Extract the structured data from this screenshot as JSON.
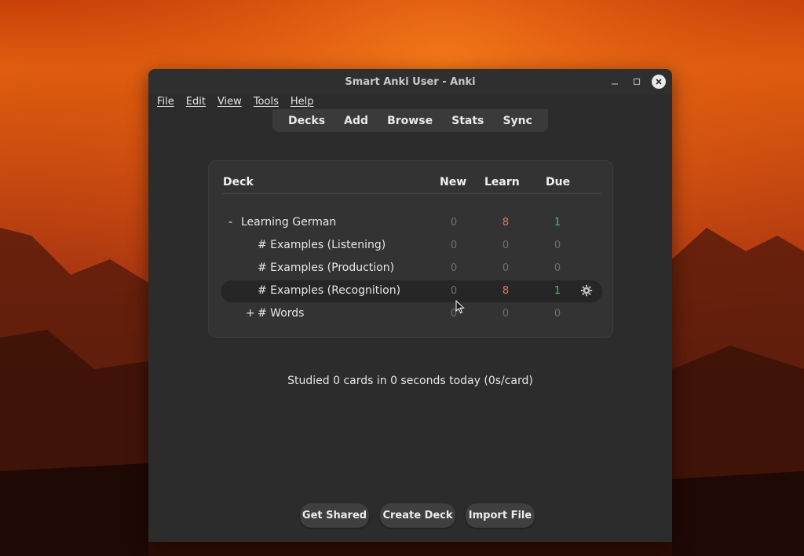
{
  "window": {
    "title": "Smart Anki User - Anki"
  },
  "menubar": [
    "File",
    "Edit",
    "View",
    "Tools",
    "Help"
  ],
  "toolbar": [
    "Decks",
    "Add",
    "Browse",
    "Stats",
    "Sync"
  ],
  "deck_table": {
    "headers": {
      "deck": "Deck",
      "new": "New",
      "learn": "Learn",
      "due": "Due"
    },
    "rows": [
      {
        "expander": "-",
        "name": "Learning German",
        "new": "0",
        "learn": "8",
        "due": "1"
      },
      {
        "expander": "",
        "name": "# Examples (Listening)",
        "new": "0",
        "learn": "0",
        "due": "0"
      },
      {
        "expander": "",
        "name": "# Examples (Production)",
        "new": "0",
        "learn": "0",
        "due": "0"
      },
      {
        "expander": "",
        "name": "# Examples (Recognition)",
        "new": "0",
        "learn": "8",
        "due": "1",
        "selected": true
      },
      {
        "expander": "+",
        "name": "# Words",
        "new": "0",
        "learn": "0",
        "due": "0"
      }
    ]
  },
  "status_text": "Studied 0 cards in 0 seconds today (0s/card)",
  "bottom_buttons": [
    "Get Shared",
    "Create Deck",
    "Import File"
  ],
  "icons": {
    "minimize": "minimize-icon",
    "maximize": "maximize-icon",
    "close": "close-icon",
    "options": "gear-icon"
  },
  "colors": {
    "learn": "#e57366",
    "due": "#4fbf66",
    "zero": "#6e6e6e"
  }
}
